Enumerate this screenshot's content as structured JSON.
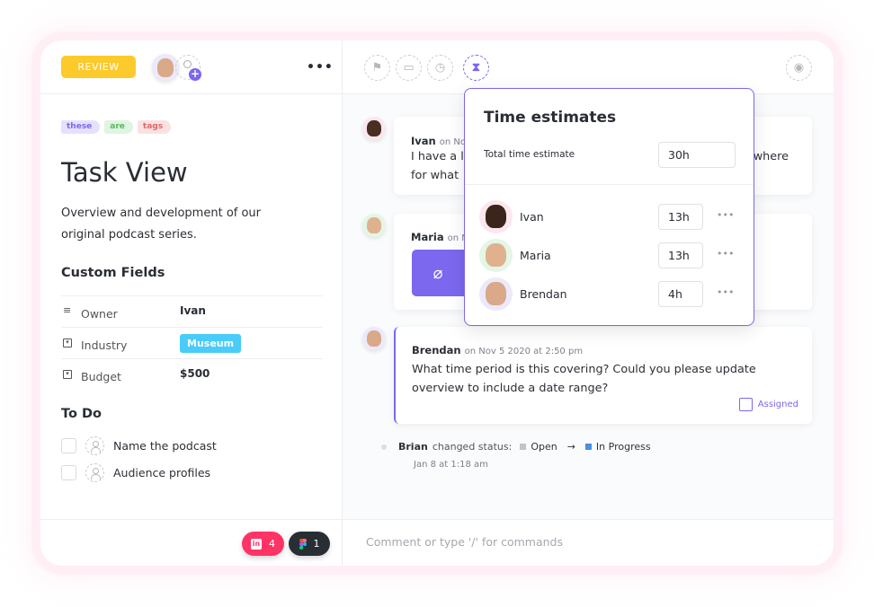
{
  "task": {
    "status": "REVIEW",
    "tags": [
      {
        "label": "these",
        "bg": "#e5e1fd",
        "color": "#7b68ee"
      },
      {
        "label": "are",
        "bg": "#e0f4e2",
        "color": "#5bb85d"
      },
      {
        "label": "tags",
        "bg": "#fbe1e1",
        "color": "#e06666"
      }
    ],
    "title": "Task View",
    "description": "Overview and development of our original podcast series.",
    "custom_fields_heading": "Custom Fields",
    "custom_fields": [
      {
        "label": "Owner",
        "value": "Ivan"
      },
      {
        "label": "Industry",
        "value": "Museum"
      },
      {
        "label": "Budget",
        "value": "$500"
      }
    ],
    "todo_heading": "To Do",
    "todos": [
      "Name the podcast",
      "Audience profiles"
    ],
    "integrations": [
      {
        "name": "invision",
        "count": "4",
        "color": "#ff3366"
      },
      {
        "name": "figma",
        "count": "1",
        "color": "#292d34"
      }
    ]
  },
  "toolbar": {
    "icons": [
      "flag-icon",
      "calendar-icon",
      "clock-icon",
      "hourglass-icon",
      "eye-icon"
    ],
    "active": "hourglass-icon",
    "accent": "#7b68ee"
  },
  "comments": [
    {
      "author": "Ivan",
      "meta": "on No",
      "line1_start": "I have a l",
      "line1_end": "where",
      "line2_start": "for what"
    },
    {
      "author": "Maria",
      "meta": "on N"
    },
    {
      "author": "Brendan",
      "meta": "on Nov 5 2020 at 2:50 pm",
      "body": "What time period is this covering? Could you please update overview to include a date range?",
      "assigned_label": "Assigned"
    }
  ],
  "activity": {
    "author": "Brian",
    "action": "changed status:",
    "from": "Open",
    "to": "In Progress",
    "from_color": "#c4c4c4",
    "to_color": "#4a90e2",
    "time": "Jan 8 at 1:18 am"
  },
  "time_estimates": {
    "title": "Time estimates",
    "total_label": "Total time estimate",
    "total": "30h",
    "people": [
      {
        "name": "Ivan",
        "value": "13h"
      },
      {
        "name": "Maria",
        "value": "13h"
      },
      {
        "name": "Brendan",
        "value": "4h"
      }
    ]
  },
  "comment_input": {
    "placeholder": "Comment or type '/' for commands"
  }
}
